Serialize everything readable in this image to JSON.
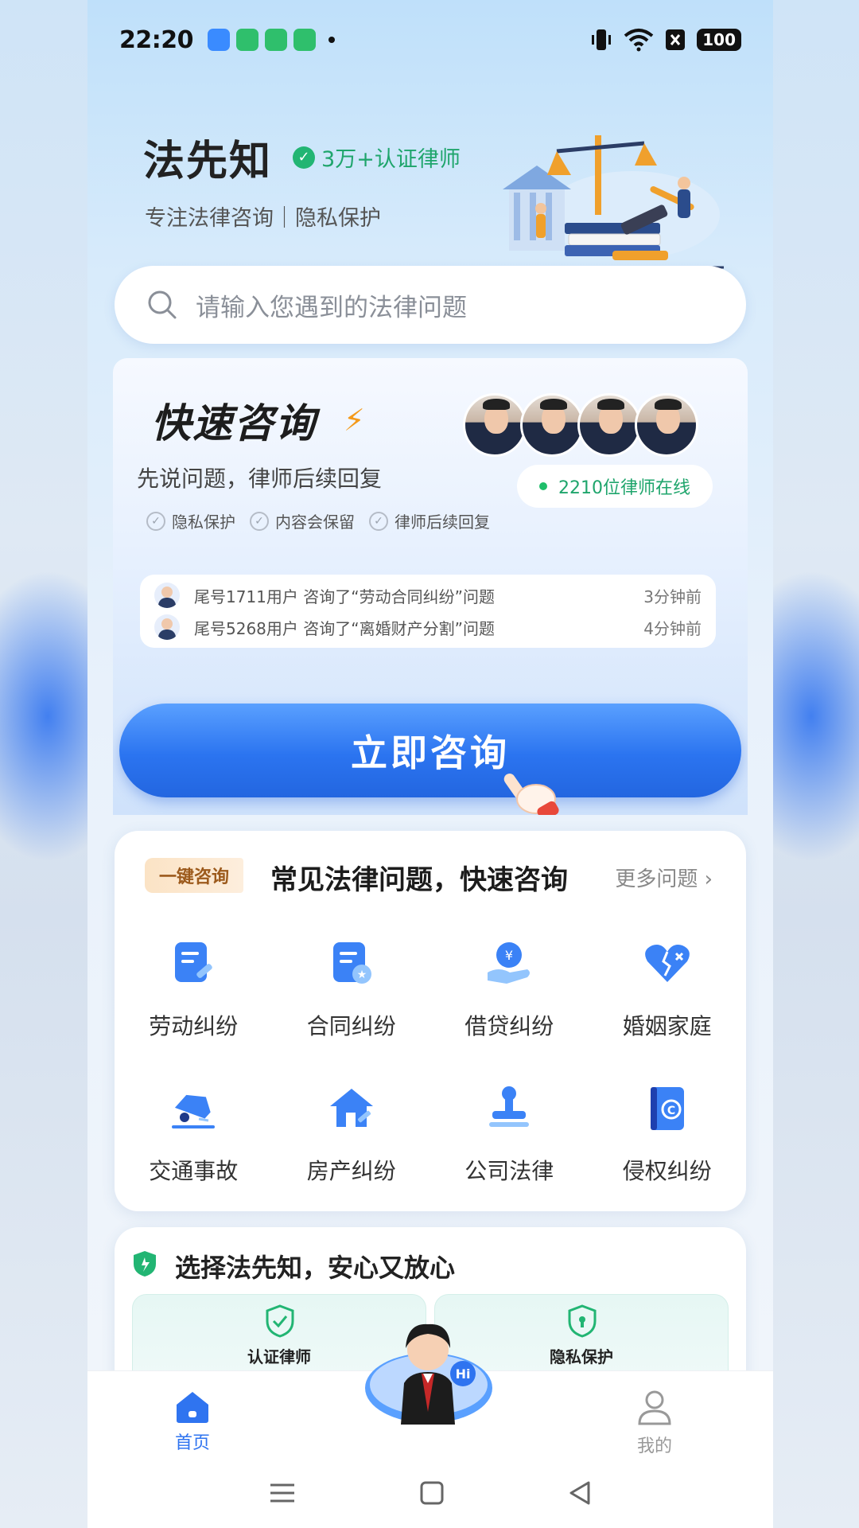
{
  "status_bar": {
    "time": "22:20",
    "battery": "100",
    "app_colors": [
      "#3a8bff",
      "#2fbf6c",
      "#2fbf6c",
      "#2fbf6c"
    ],
    "icons": [
      "vibrate-icon",
      "wifi-icon",
      "x-box-icon",
      "battery-icon"
    ]
  },
  "header": {
    "brand_name": "法先知",
    "cert_label": "3万+认证律师",
    "slogan": "专注法律咨询｜隐私保护"
  },
  "search": {
    "placeholder": "请输入您遇到的法律问题"
  },
  "quick_consult": {
    "title": "快速咨询",
    "subtitle": "先说问题，律师后续回复",
    "online_label": "2210位律师在线",
    "features": [
      "隐私保护",
      "内容会保留",
      "律师后续回复"
    ],
    "feed": [
      {
        "text": "尾号1711用户 咨询了“劳动合同纠纷”问题",
        "time": "3分钟前"
      },
      {
        "text": "尾号5268用户 咨询了“离婚财产分割”问题",
        "time": "4分钟前"
      }
    ],
    "cta_label": "立即咨询"
  },
  "common": {
    "tag": "一键咨询",
    "title": "常见法律问题，快速咨询",
    "more_label": "更多问题 ›",
    "items": [
      {
        "label": "劳动纠纷",
        "icon": "labor-document-icon"
      },
      {
        "label": "合同纠纷",
        "icon": "contract-icon"
      },
      {
        "label": "借贷纠纷",
        "icon": "loan-yen-icon"
      },
      {
        "label": "婚姻家庭",
        "icon": "broken-heart-icon"
      },
      {
        "label": "交通事故",
        "icon": "car-accident-icon"
      },
      {
        "label": "房产纠纷",
        "icon": "house-icon"
      },
      {
        "label": "公司法律",
        "icon": "company-stamp-icon"
      },
      {
        "label": "侵权纠纷",
        "icon": "copyright-book-icon"
      }
    ]
  },
  "choose": {
    "title": "选择法先知，安心又放心",
    "boxes": [
      "认证律师",
      "隐私保护"
    ]
  },
  "bottom_nav": {
    "home_label": "首页",
    "me_label": "我的",
    "assistant_badge": "Hi"
  },
  "colors": {
    "accent_blue": "#2f74f0",
    "accent_green": "#1fa56c",
    "tag_orange": "#9c5a1c"
  }
}
